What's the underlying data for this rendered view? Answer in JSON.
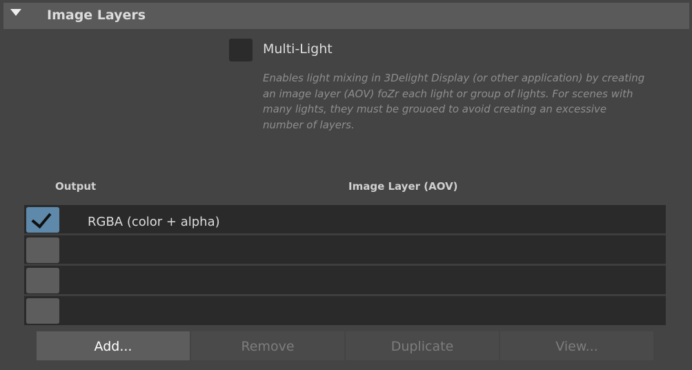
{
  "section": {
    "title": "Image Layers"
  },
  "multilight": {
    "label": "Multi-Light",
    "checked": false,
    "description": "Enables light mixing in 3Delight Display (or other application) by creating an image layer (AOV) foZr each light or group of lights. For scenes with many lights, they must be grouoed to avoid creating an excessive number of layers."
  },
  "table": {
    "columns": {
      "output": "Output",
      "aov": "Image Layer (AOV)"
    },
    "rows": [
      {
        "checked": true,
        "label": "RGBA (color + alpha)"
      },
      {
        "checked": false,
        "label": ""
      },
      {
        "checked": false,
        "label": ""
      },
      {
        "checked": false,
        "label": ""
      }
    ]
  },
  "buttons": {
    "add": "Add...",
    "remove": "Remove",
    "duplicate": "Duplicate",
    "view": "View..."
  },
  "colors": {
    "accent_checked": "#5e89aa",
    "panel_bg": "#444444",
    "header_bg": "#5a5a5a",
    "table_bg": "#2a2a2a"
  }
}
